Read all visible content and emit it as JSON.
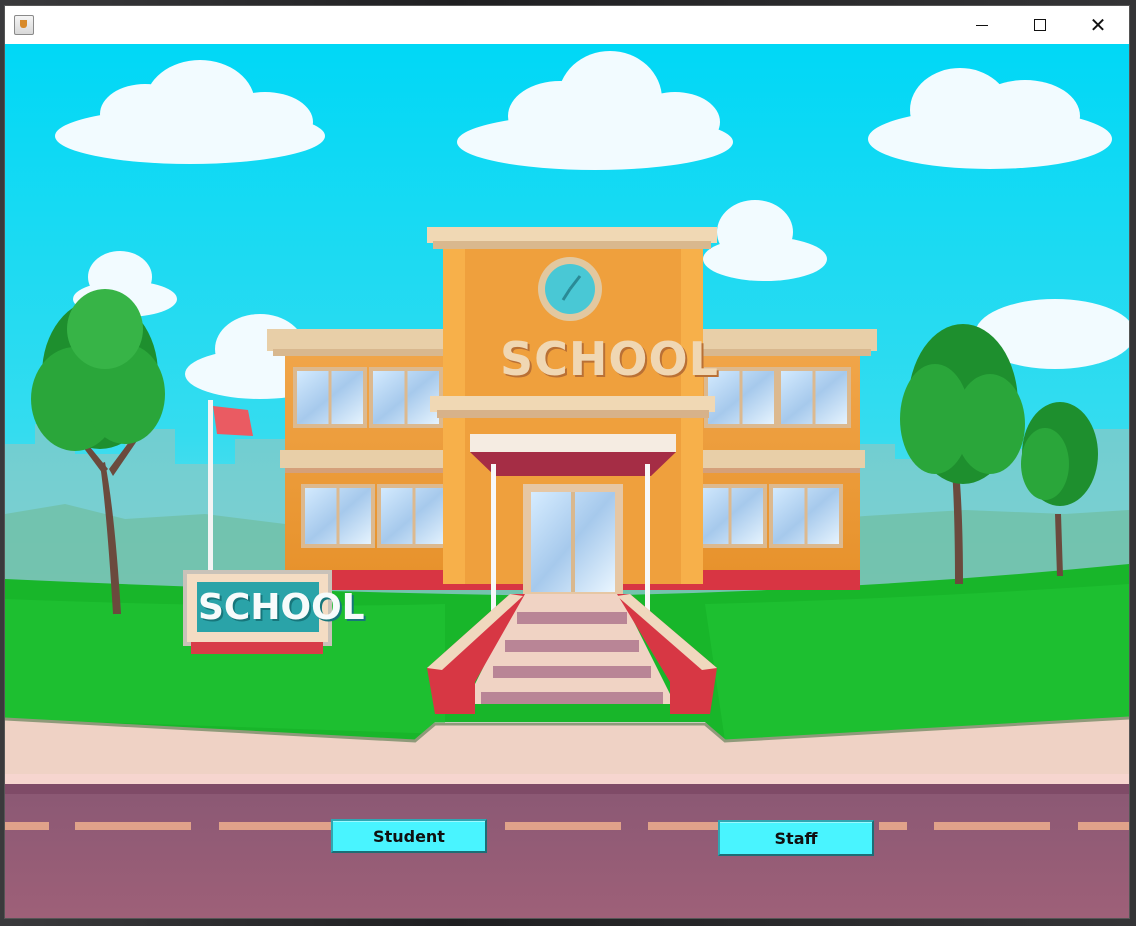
{
  "window": {
    "title": "",
    "controls": [
      "minimize",
      "maximize",
      "close"
    ]
  },
  "scene": {
    "building_sign": "SCHOOL",
    "yard_sign": "SCHOOL"
  },
  "buttons": {
    "student_label": "Student",
    "staff_label": "Staff"
  },
  "colors": {
    "sky": "#17d7f2",
    "grass": "#1fb32f",
    "road": "#8e5d75",
    "button": "#49f4ff"
  },
  "icons": {
    "app": "java-cup-icon",
    "minimize": "minimize-icon",
    "maximize": "maximize-icon",
    "close": "close-icon"
  }
}
